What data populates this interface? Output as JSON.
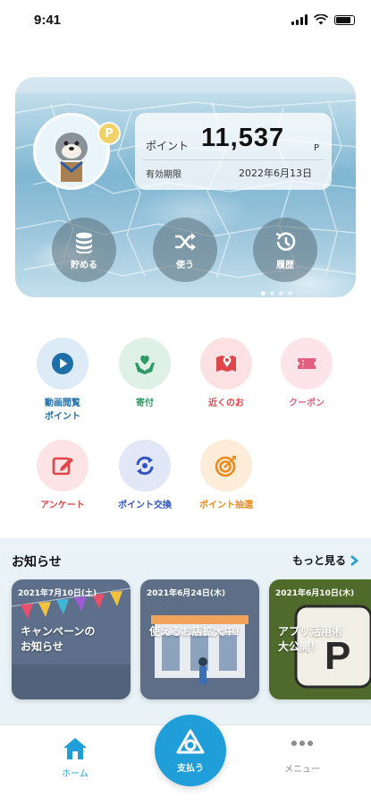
{
  "status_bar": {
    "time": "9:41"
  },
  "point_card": {
    "point_label": "ポイント",
    "point_value": "11,537",
    "point_unit": "P",
    "expiry_label": "有効期限",
    "expiry_value": "2022年6月13日",
    "coin_symbol": "P",
    "actions": [
      {
        "label": "貯める",
        "icon": "coins-icon"
      },
      {
        "label": "使う",
        "icon": "shuffle-icon"
      },
      {
        "label": "履歴",
        "icon": "history-icon"
      }
    ],
    "carousel_pages": 4,
    "carousel_active": 1
  },
  "menu": [
    {
      "label": "動画閲覧\nポイント",
      "icon": "play-icon",
      "color": "#1e6fa8",
      "bg": "#dcebf6"
    },
    {
      "label": "寄付",
      "icon": "heart-hands-icon",
      "color": "#2f9a63",
      "bg": "#dff1e6"
    },
    {
      "label": "近くのお",
      "icon": "map-pin-icon",
      "color": "#e0454a",
      "bg": "#fbe1e2"
    },
    {
      "label": "クーポン",
      "icon": "ticket-icon",
      "color": "#e45f7f",
      "bg": "#fde3ea"
    },
    {
      "label": "アンケート",
      "icon": "edit-icon",
      "color": "#e0454a",
      "bg": "#fde3e3"
    },
    {
      "label": "ポイント交換",
      "icon": "exchange-icon",
      "color": "#2f54c2",
      "bg": "#e2e7f8"
    },
    {
      "label": "ポイント抽選",
      "icon": "target-icon",
      "color": "#ec8a1d",
      "bg": "#fdecd8"
    }
  ],
  "news": {
    "title": "お知らせ",
    "more_label": "もっと見る",
    "cards": [
      {
        "date": "2021年7月10日(土)",
        "headline": "キャンペーンの\nお知らせ",
        "bg": "#5d6f8a"
      },
      {
        "date": "2021年6月24日(木)",
        "headline": "使えるお店拡大中！",
        "bg": "#5e6e86"
      },
      {
        "date": "2021年6月10日(木)",
        "headline": "アプリ活用術\n大公開！",
        "bg": "#4f6a2b",
        "badge": "P"
      }
    ]
  },
  "bottom_nav": {
    "home_label": "ホーム",
    "pay_label": "支払う",
    "menu_label": "メニュー",
    "home_color": "#1f9ed9"
  }
}
